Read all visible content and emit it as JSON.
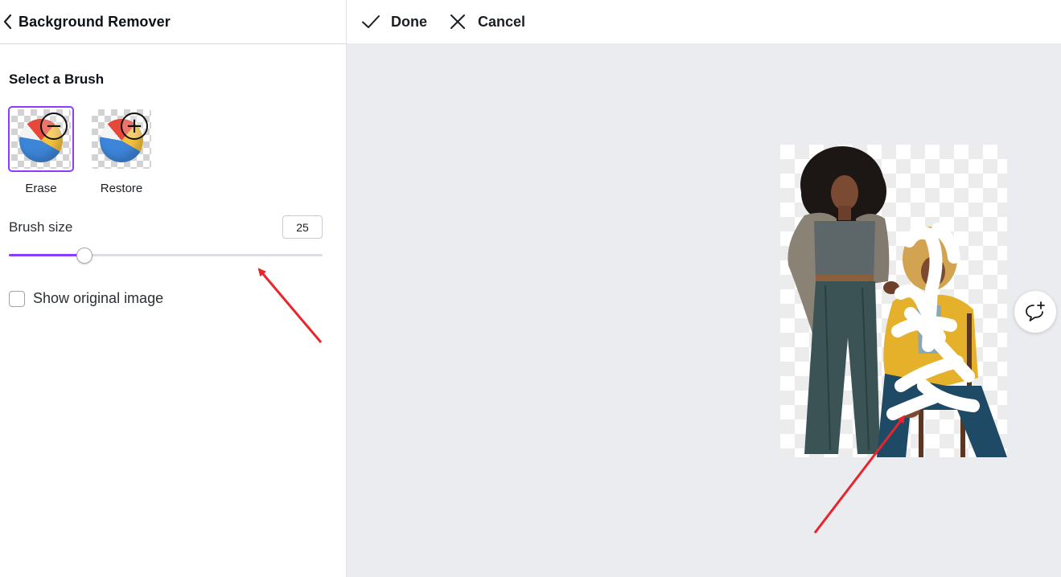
{
  "panel": {
    "title": "Background Remover",
    "section_title": "Select a Brush",
    "brushes": [
      {
        "label": "Erase",
        "selected": true,
        "icon": "minus-circle-icon"
      },
      {
        "label": "Restore",
        "selected": false,
        "icon": "plus-circle-icon"
      }
    ],
    "brush_size": {
      "label": "Brush size",
      "value": "25",
      "slider_fraction": 0.24
    },
    "show_original": {
      "label": "Show original image",
      "checked": false
    }
  },
  "toolbar": {
    "done_label": "Done",
    "cancel_label": "Cancel"
  },
  "canvas": {
    "background": "#ebecf0",
    "accent": "#8b3dff",
    "annotation_color": "#e8252a"
  }
}
